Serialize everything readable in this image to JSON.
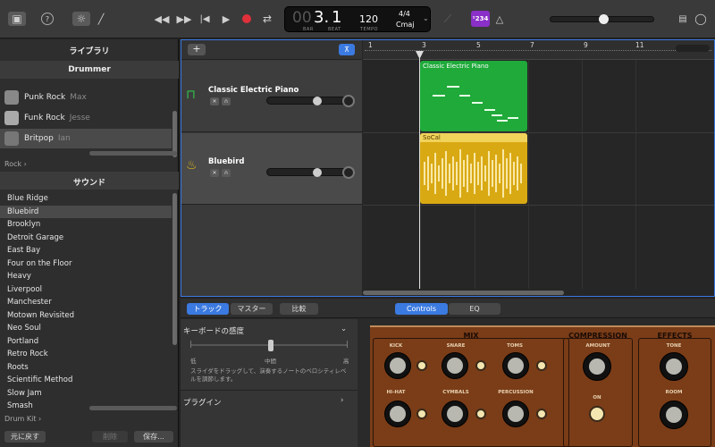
{
  "toolbar": {
    "icons": [
      "library-icon",
      "help-icon",
      "smart-controls-icon",
      "pencil-icon",
      "rewind-icon",
      "fast-forward-icon",
      "to-start-icon",
      "play-icon",
      "record-icon",
      "cycle-icon",
      "tuner-icon",
      "count-in-icon",
      "metronome-icon",
      "notepad-icon",
      "loop-browser-icon"
    ],
    "help": "?",
    "lcd": {
      "bar": "00",
      "beat_main": "3.",
      "beat_sub": "1",
      "bar_label": "BAR",
      "beat_label": "BEAT",
      "tempo": "120",
      "tempo_label": "TEMPO",
      "signature": "4/4",
      "key": "Cmaj"
    },
    "count_in": "¹234",
    "master_volume": 0.5,
    "accent": "#3b7ae0",
    "record_color": "#e0303a",
    "countin_color": "#8a2fc8"
  },
  "library": {
    "title": "ライブラリ",
    "drummer_header": "Drummer",
    "drummers": [
      {
        "name": "Punk Rock",
        "player": "Max"
      },
      {
        "name": "Funk Rock",
        "player": "Jesse"
      },
      {
        "name": "Britpop",
        "player": "Ian"
      }
    ],
    "genre_crumb": "Rock",
    "sound_header": "サウンド",
    "sounds": [
      "Blue Ridge",
      "Bluebird",
      "Brooklyn",
      "Detroit Garage",
      "East Bay",
      "Four on the Floor",
      "Heavy",
      "Liverpool",
      "Manchester",
      "Motown Revisited",
      "Neo Soul",
      "Portland",
      "Retro Rock",
      "Roots",
      "Scientific Method",
      "Slow Jam",
      "Smash"
    ],
    "selected_sound": "Bluebird",
    "kit_crumb": "Drum Kit",
    "revert": "元に戻す",
    "delete": "削除",
    "save": "保存..."
  },
  "tracks": {
    "add": "+",
    "ruler": [
      "1",
      "3",
      "5",
      "7",
      "9",
      "11"
    ],
    "items": [
      {
        "name": "Classic Electric Piano",
        "region": "Classic Electric Piano",
        "color": "#1faa3a",
        "volume": 0.6
      },
      {
        "name": "Bluebird",
        "region": "SoCal",
        "color": "#e0b81c",
        "volume": 0.6
      }
    ]
  },
  "smart": {
    "tabs": [
      "トラック",
      "マスター",
      "比較"
    ],
    "mode_tabs": [
      "Controls",
      "EQ"
    ],
    "keyboard_sensitivity": "キーボードの感度",
    "low": "低",
    "mid": "中間",
    "high": "高",
    "description": "スライダをドラッグして、演奏するノートのベロシティレベルを調節します。",
    "plugins": "プラグイン",
    "sensitivity_value": 0.5,
    "mix_title": "MIX",
    "compression_title": "COMPRESSION",
    "effects_title": "EFFECTS",
    "knobs": {
      "kick": "KICK",
      "snare": "SNARE",
      "toms": "TOMS",
      "hihat": "HI-HAT",
      "cymbals": "CYMBALS",
      "percussion": "PERCUSSION",
      "amount": "AMOUNT",
      "on": "ON",
      "tone": "TONE",
      "room": "ROOM"
    }
  }
}
